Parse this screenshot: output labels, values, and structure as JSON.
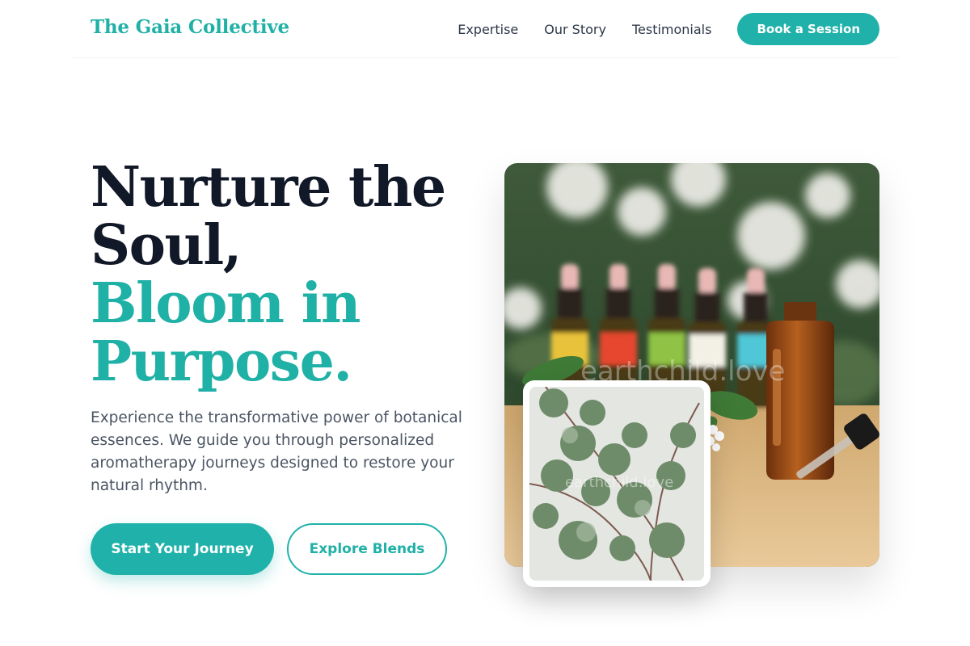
{
  "brand": {
    "name": "The Gaia Collective",
    "accent_color": "#20b2aa"
  },
  "nav": {
    "links": [
      "Expertise",
      "Our Story",
      "Testimonials"
    ],
    "cta_label": "Book a Session"
  },
  "hero": {
    "title_line_1": "Nurture the",
    "title_line_2": "Soul,",
    "title_accent_line_1": "Bloom in",
    "title_accent_line_2": "Purpose.",
    "description": "Experience the transformative power of botanical essences. We guide you through personalized aromatherapy journeys designed to restore your natural rhythm.",
    "primary_button": "Start Your Journey",
    "secondary_button": "Explore Blends",
    "main_image_watermark": "earthchild.love",
    "inset_image_watermark": "earthchild.love"
  },
  "icons": {
    "main_image": "essential-oil-bottles-photo",
    "inset_image": "eucalyptus-leaves-photo"
  }
}
